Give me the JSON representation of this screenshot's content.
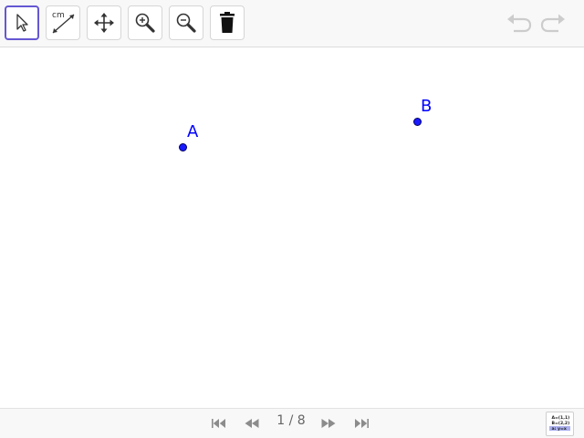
{
  "toolbar": {
    "tools": [
      {
        "name": "move-tool",
        "icon": "cursor-arrow-icon",
        "selected": true
      },
      {
        "name": "distance-tool",
        "icon": "ruler-distance-icon",
        "label": "cm"
      },
      {
        "name": "move-graphics-view-tool",
        "icon": "four-arrows-icon"
      },
      {
        "name": "zoom-in-tool",
        "icon": "zoom-in-icon"
      },
      {
        "name": "zoom-out-tool",
        "icon": "zoom-out-icon"
      },
      {
        "name": "delete-tool",
        "icon": "trash-icon"
      }
    ],
    "undo_icon": "undo-icon",
    "redo_icon": "redo-icon"
  },
  "canvas": {
    "points": [
      {
        "label": "A"
      },
      {
        "label": "B"
      }
    ],
    "point_color": "#1a1aff",
    "label_color": "#0000ff"
  },
  "bottombar": {
    "page_indicator": "1 / 8",
    "icons": [
      "first-page-icon",
      "previous-page-icon",
      "next-page-icon",
      "last-page-icon"
    ],
    "algebra_view": {
      "icon": "algebra-view-icon",
      "lines": [
        "A=(1,1)",
        "B=(2,2)",
        "a: y=x"
      ]
    }
  },
  "colors": {
    "selection_border": "#6557d2",
    "icon_dark": "#333333",
    "icon_disabled": "#cccccc",
    "nav_icon": "#8c8c8c"
  }
}
